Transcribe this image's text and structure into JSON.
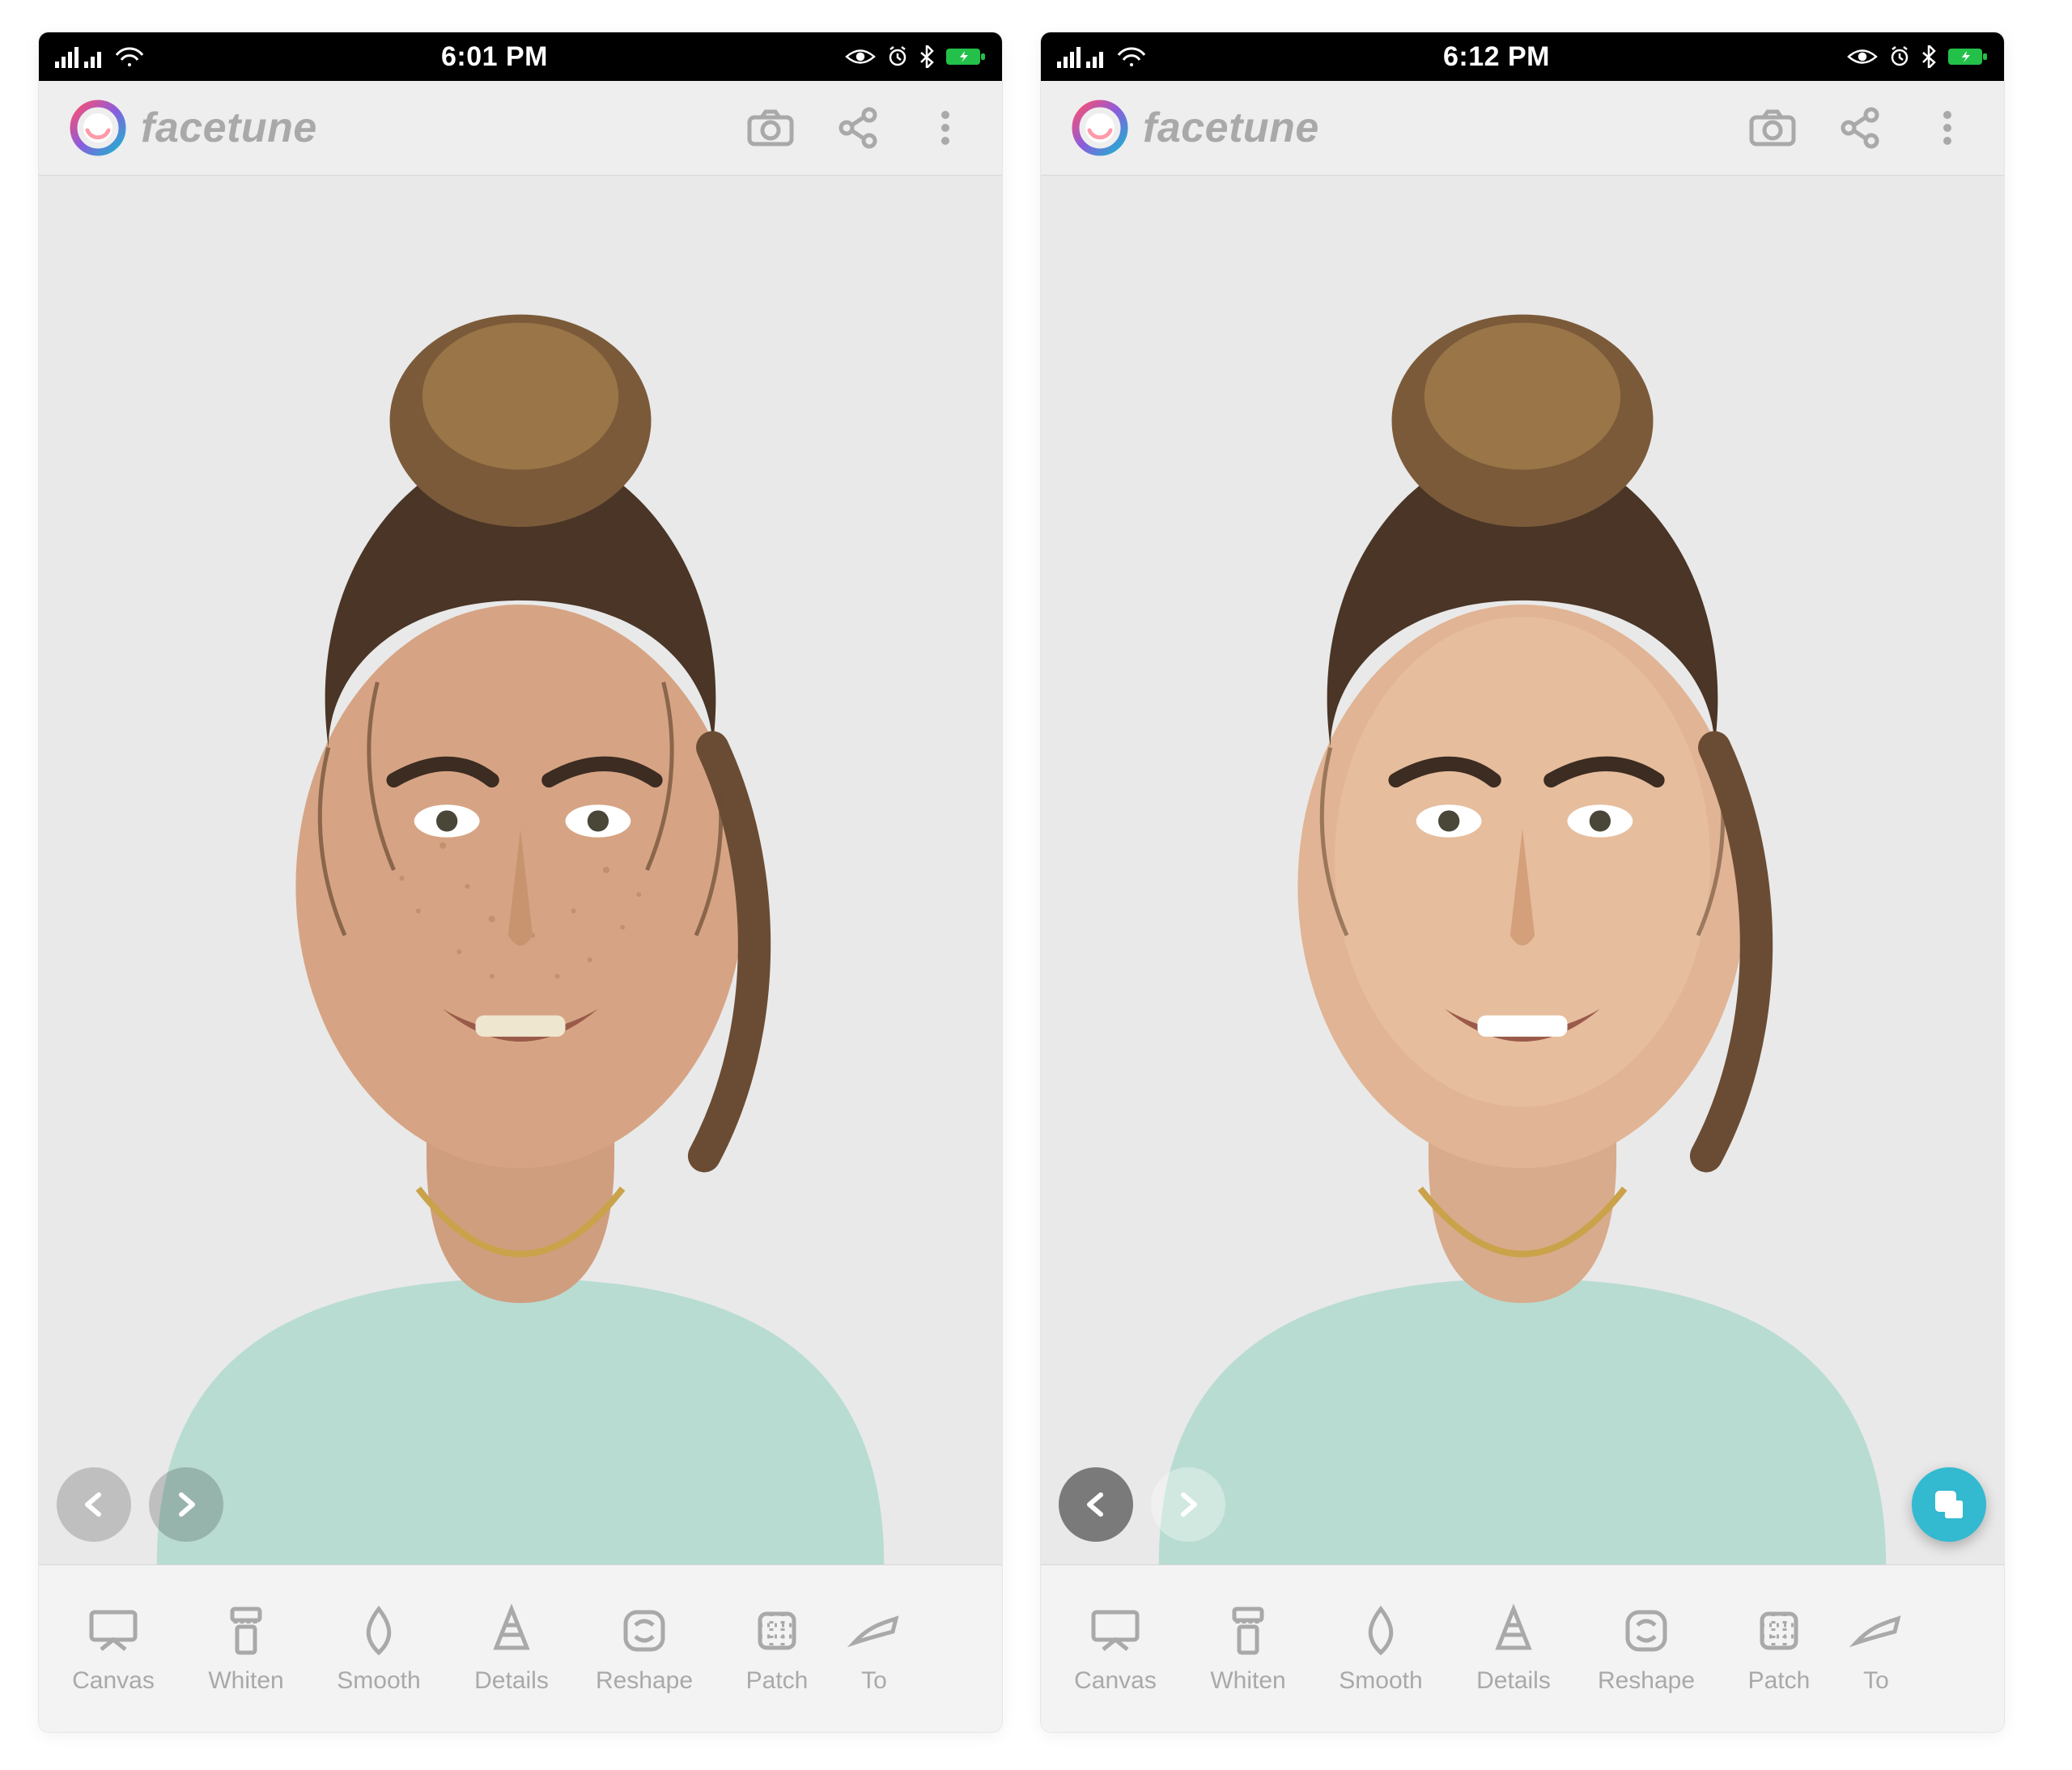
{
  "phones": [
    {
      "status": {
        "time": "6:01 PM"
      },
      "header": {
        "app_name": "facetune"
      },
      "overlay": {
        "back_fwd_style": "dim",
        "show_fab": false
      },
      "tools": [
        {
          "key": "canvas",
          "label": "Canvas"
        },
        {
          "key": "whiten",
          "label": "Whiten"
        },
        {
          "key": "smooth",
          "label": "Smooth"
        },
        {
          "key": "details",
          "label": "Details"
        },
        {
          "key": "reshape",
          "label": "Reshape"
        },
        {
          "key": "patch",
          "label": "Patch"
        },
        {
          "key": "tones",
          "label": "To"
        }
      ]
    },
    {
      "status": {
        "time": "6:12 PM"
      },
      "header": {
        "app_name": "facetune"
      },
      "overlay": {
        "back_fwd_style": "solid",
        "show_fab": true
      },
      "tools": [
        {
          "key": "canvas",
          "label": "Canvas"
        },
        {
          "key": "whiten",
          "label": "Whiten"
        },
        {
          "key": "smooth",
          "label": "Smooth"
        },
        {
          "key": "details",
          "label": "Details"
        },
        {
          "key": "reshape",
          "label": "Reshape"
        },
        {
          "key": "patch",
          "label": "Patch"
        },
        {
          "key": "tones",
          "label": "To"
        }
      ]
    }
  ]
}
